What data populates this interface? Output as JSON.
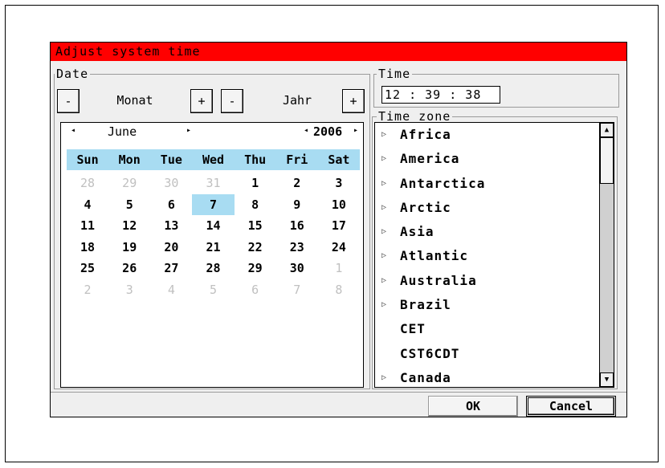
{
  "dialog": {
    "title": "Adjust system time"
  },
  "date": {
    "group_label": "Date",
    "month_minus": "-",
    "month_label": "Monat",
    "month_plus": "+",
    "year_minus": "-",
    "year_label": "Jahr",
    "year_plus": "+"
  },
  "calendar": {
    "prev_month_arrow": "◂",
    "month": "June",
    "next_month_arrow": "▸",
    "prev_year_arrow": "◂",
    "year": "2006",
    "next_year_arrow": "▸",
    "weekdays": [
      "Sun",
      "Mon",
      "Tue",
      "Wed",
      "Thu",
      "Fri",
      "Sat"
    ],
    "weeks": [
      [
        "28",
        "29",
        "30",
        "31",
        "1",
        "2",
        "3"
      ],
      [
        "4",
        "5",
        "6",
        "7",
        "8",
        "9",
        "10"
      ],
      [
        "11",
        "12",
        "13",
        "14",
        "15",
        "16",
        "17"
      ],
      [
        "18",
        "19",
        "20",
        "21",
        "22",
        "23",
        "24"
      ],
      [
        "25",
        "26",
        "27",
        "28",
        "29",
        "30",
        "1"
      ],
      [
        "2",
        "3",
        "4",
        "5",
        "6",
        "7",
        "8"
      ]
    ],
    "selected": "7"
  },
  "time": {
    "group_label": "Time",
    "value": "12 : 39 : 38"
  },
  "timezone": {
    "group_label": "Time zone",
    "items": [
      {
        "label": "Africa",
        "expandable": true
      },
      {
        "label": "America",
        "expandable": true
      },
      {
        "label": "Antarctica",
        "expandable": true
      },
      {
        "label": "Arctic",
        "expandable": true
      },
      {
        "label": "Asia",
        "expandable": true
      },
      {
        "label": "Atlantic",
        "expandable": true
      },
      {
        "label": "Australia",
        "expandable": true
      },
      {
        "label": "Brazil",
        "expandable": true
      },
      {
        "label": "CET",
        "expandable": false
      },
      {
        "label": "CST6CDT",
        "expandable": false
      },
      {
        "label": "Canada",
        "expandable": true
      }
    ],
    "expand_icon": "▷",
    "scroll_up": "▲",
    "scroll_down": "▼"
  },
  "buttons": {
    "ok": "OK",
    "cancel": "Cancel"
  },
  "colors": {
    "titlebar": "#ff0000",
    "highlight": "#a8dcf2"
  }
}
